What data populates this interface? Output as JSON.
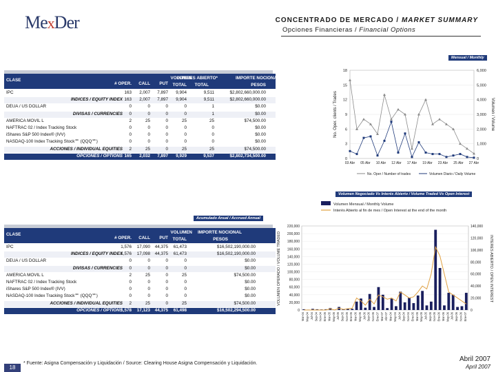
{
  "header": {
    "logo_main": "Me",
    "logo_x": "x",
    "logo_end": "Der",
    "title": "CONCENTRADO DE MERCADO / MARKET SUMMARY",
    "title_es": "CONCENTRADO DE MERCADO / ",
    "title_en": "MARKET SUMMARY",
    "subtitle_es": "Opciones Financieras / ",
    "subtitle_en": "Financial Options"
  },
  "monthly_tag": "Mensual / Monthly",
  "annual_tag": "Acumulado Anual / Accrued Annual",
  "chart2_tag": "Volumen Negociado Vs Interés Abierto / Volume Traded Vs Open Interest",
  "columns": [
    "CLASE",
    "# OPER.",
    "CALL",
    "PUT",
    "VOLUMEN TOTAL",
    "INTERES ABIERTO* TOTAL",
    "IMPORTE NOCIONAL PESOS"
  ],
  "columns_split": {
    "clase": "CLASE",
    "oper": "# OPER.",
    "call": "CALL",
    "put": "PUT",
    "vol1": "VOLUMEN",
    "vol2": "TOTAL",
    "oi1": "INTERES ABIERTO*",
    "oi2": "TOTAL",
    "imp1": "IMPORTE NOCIONAL",
    "imp2": "PESOS"
  },
  "monthly_table": {
    "rows": [
      {
        "label": "IPC",
        "values": [
          "163",
          "2,007",
          "7,897",
          "9,904",
          "9,511",
          "$2,802,660,000.00"
        ]
      },
      {
        "label": "INDICES / EQUITY INDEX",
        "sub": true,
        "values": [
          "163",
          "2,007",
          "7,897",
          "9,904",
          "9,511",
          "$2,802,660,000.00"
        ]
      },
      {
        "label": "DEUA / US DOLLAR",
        "values": [
          "0",
          "0",
          "0",
          "0",
          "1",
          "$0.00"
        ]
      },
      {
        "label": "DIVISAS / CURRENCIES",
        "sub": true,
        "values": [
          "0",
          "0",
          "0",
          "0",
          "1",
          "$0.00"
        ]
      },
      {
        "label": "AMERICA MOVIL L",
        "values": [
          "2",
          "25",
          "0",
          "25",
          "25",
          "$74,500.00"
        ]
      },
      {
        "label": "NAFTRAC 02 / Index Tracking Stock",
        "values": [
          "0",
          "0",
          "0",
          "0",
          "0",
          "$0.00"
        ]
      },
      {
        "label": "iShares S&P 500 Index® (IVV)",
        "values": [
          "0",
          "0",
          "0",
          "0",
          "0",
          "$0.00"
        ]
      },
      {
        "label": "NASDAQ-100 Index Tracking Stock℠ (QQQ℠)",
        "values": [
          "0",
          "0",
          "0",
          "0",
          "0",
          "$0.00"
        ]
      },
      {
        "label": "ACCIONES / INDIVIDUAL EQUITIES",
        "sub": true,
        "values": [
          "2",
          "25",
          "0",
          "25",
          "25",
          "$74,500.00"
        ]
      },
      {
        "label": "OPCIONES / OPTIONS",
        "total": true,
        "values": [
          "165",
          "2,032",
          "7,897",
          "9,929",
          "9,537",
          "$2,802,734,500.00"
        ]
      }
    ]
  },
  "annual_table": {
    "rows": [
      {
        "label": "IPC",
        "values": [
          "1,576",
          "17,090",
          "44,375",
          "61,473",
          "",
          "$16,502,190,000.00"
        ]
      },
      {
        "label": "INDICES / EQUITY INDEX",
        "sub": true,
        "values": [
          "1,576",
          "17,098",
          "44,375",
          "61,473",
          "",
          "$16,502,190,000.00"
        ]
      },
      {
        "label": "DEUA / US DOLLAR",
        "values": [
          "0",
          "0",
          "0",
          "0",
          "",
          "$0.00"
        ]
      },
      {
        "label": "DIVISAS / CURRENCIES",
        "sub": true,
        "values": [
          "0",
          "0",
          "0",
          "0",
          "",
          "$0.00"
        ]
      },
      {
        "label": "AMERICA MOVIL L",
        "values": [
          "2",
          "25",
          "0",
          "25",
          "",
          "$74,500.00"
        ]
      },
      {
        "label": "NAFTRAC 02 / Index Tracking Stock",
        "values": [
          "0",
          "0",
          "0",
          "0",
          "",
          "$0.00"
        ]
      },
      {
        "label": "iShares S&P 500 Index® (IVV)",
        "values": [
          "0",
          "0",
          "0",
          "0",
          "",
          "$0.00"
        ]
      },
      {
        "label": "NASDAQ-100 Index Tracking Stock℠ (QQQ℠)",
        "values": [
          "0",
          "0",
          "0",
          "0",
          "",
          "$0.00"
        ]
      },
      {
        "label": "ACCIONES / INDIVIDUAL EQUITIES",
        "sub": true,
        "values": [
          "2",
          "25",
          "0",
          "25",
          "",
          "$74,500.00"
        ]
      },
      {
        "label": "OPCIONES / OPTIONS",
        "total": true,
        "values": [
          "1,578",
          "17,123",
          "44,375",
          "61,498",
          "",
          "$16,502,294,500.00"
        ]
      }
    ]
  },
  "chart_data": [
    {
      "type": "line",
      "title": "",
      "categories": [
        "03 Abr",
        "05 Abr",
        "10 Abr",
        "12 Abr",
        "17 Abr",
        "19 Abr",
        "23 Abr",
        "25 Abr",
        "27 Abr"
      ],
      "left_axis_label": "No. Oper. clients / Trades",
      "right_axis_label": "Volumen / Volume",
      "left_ylim": [
        0,
        18
      ],
      "left_ticks": [
        "0",
        "3",
        "6",
        "9",
        "12",
        "15",
        "18"
      ],
      "right_ylim": [
        0,
        6000
      ],
      "right_ticks": [
        "0",
        "1,000",
        "2,000",
        "3,000",
        "4,000",
        "5,000",
        "6,000"
      ],
      "series": [
        {
          "name": "No. Oper / Number of trades",
          "axis": "left",
          "color": "#8a8a8a",
          "values": [
            16,
            6,
            8,
            7,
            5,
            13,
            8,
            10,
            9,
            2,
            9,
            12,
            7,
            8,
            7,
            6,
            3,
            2,
            1
          ]
        },
        {
          "name": "Volumen Diario / Daily Volume",
          "axis": "right",
          "color": "#1f3a7a",
          "values": [
            500,
            300,
            1400,
            1500,
            200,
            1200,
            2500,
            400,
            1700,
            100,
            1100,
            400,
            300,
            300,
            100,
            200,
            300,
            100,
            50
          ]
        }
      ]
    },
    {
      "type": "bar",
      "title": "",
      "legend": [
        "Volumen Mensual / Monthly Volume",
        "Interés Abierto al fin de mes / Open Interest at the end of the month"
      ],
      "left_axis_label": "VOLUMEN OPERADO / VOLUME TRADED",
      "right_axis_label": "INTERES ABIERTO / OPEN INTEREST",
      "left_ylim": [
        0,
        220000
      ],
      "left_ticks": [
        "0",
        "20,000",
        "40,000",
        "60,000",
        "80,000",
        "100,000",
        "120,000",
        "140,000",
        "160,000",
        "180,000",
        "200,000",
        "220,000"
      ],
      "right_ylim": [
        0,
        140000
      ],
      "right_ticks": [
        "0",
        "20,000",
        "40,000",
        "60,000",
        "80,000",
        "100,000",
        "120,000",
        "140,000"
      ],
      "categories": [
        "Mar-04",
        "May-04",
        "Jul-04",
        "Sep-04",
        "Nov-04",
        "Ene-05",
        "Mar-05",
        "May-05",
        "Jul-05",
        "Sep-05",
        "Nov-05",
        "Ene-06",
        "Mar-06",
        "May-06",
        "Jul-06",
        "Sep-06",
        "Nov-06",
        "Ene-07",
        "Mar-07",
        "Abr-07",
        "Mar-04b",
        "May-04b",
        "Jul-04b",
        "Sep-04b",
        "Nov-04b",
        "Ene-05b",
        "Mar-05b",
        "May-05b",
        "Jul-05b",
        "Sep-05b",
        "Nov-05b",
        "Ene-06b",
        "Mar-06b",
        "May-06b",
        "Jul-06b",
        "Sep-06b",
        "Nov-06b",
        "Ene-07b"
      ],
      "series": [
        {
          "name": "Volumen Mensual / Monthly Volume",
          "axis": "left",
          "color": "#1a1f5e",
          "values": [
            2000,
            1000,
            3000,
            2000,
            1500,
            2000,
            5000,
            1000,
            8000,
            2000,
            4000,
            3000,
            22000,
            30000,
            6000,
            42000,
            8000,
            60000,
            40000,
            5000,
            30000,
            10000,
            48000,
            20000,
            32000,
            18000,
            38000,
            50000,
            12000,
            22000,
            210000,
            110000,
            12000,
            45000,
            40000,
            8000,
            10000,
            45000
          ]
        },
        {
          "name": "Interés Abierto al fin de mes / Open Interest at the end of the month",
          "axis": "right",
          "color": "#e0a040",
          "values": [
            0,
            0,
            0,
            0,
            0,
            0,
            2000,
            0,
            3000,
            1000,
            2000,
            3000,
            20000,
            15000,
            8000,
            18000,
            10000,
            25000,
            22000,
            18000,
            20000,
            15000,
            30000,
            25000,
            20000,
            22000,
            30000,
            40000,
            35000,
            60000,
            105000,
            90000,
            60000,
            30000,
            25000,
            20000,
            15000,
            10000
          ]
        }
      ]
    }
  ],
  "footer": {
    "page": "18",
    "source": "* Fuente: Asigna Compensación y Liquidación / Source: Clearing House Asigna Compensación y Liquidación.",
    "date_es": "Abril 2007",
    "date_en": "April 2007"
  }
}
